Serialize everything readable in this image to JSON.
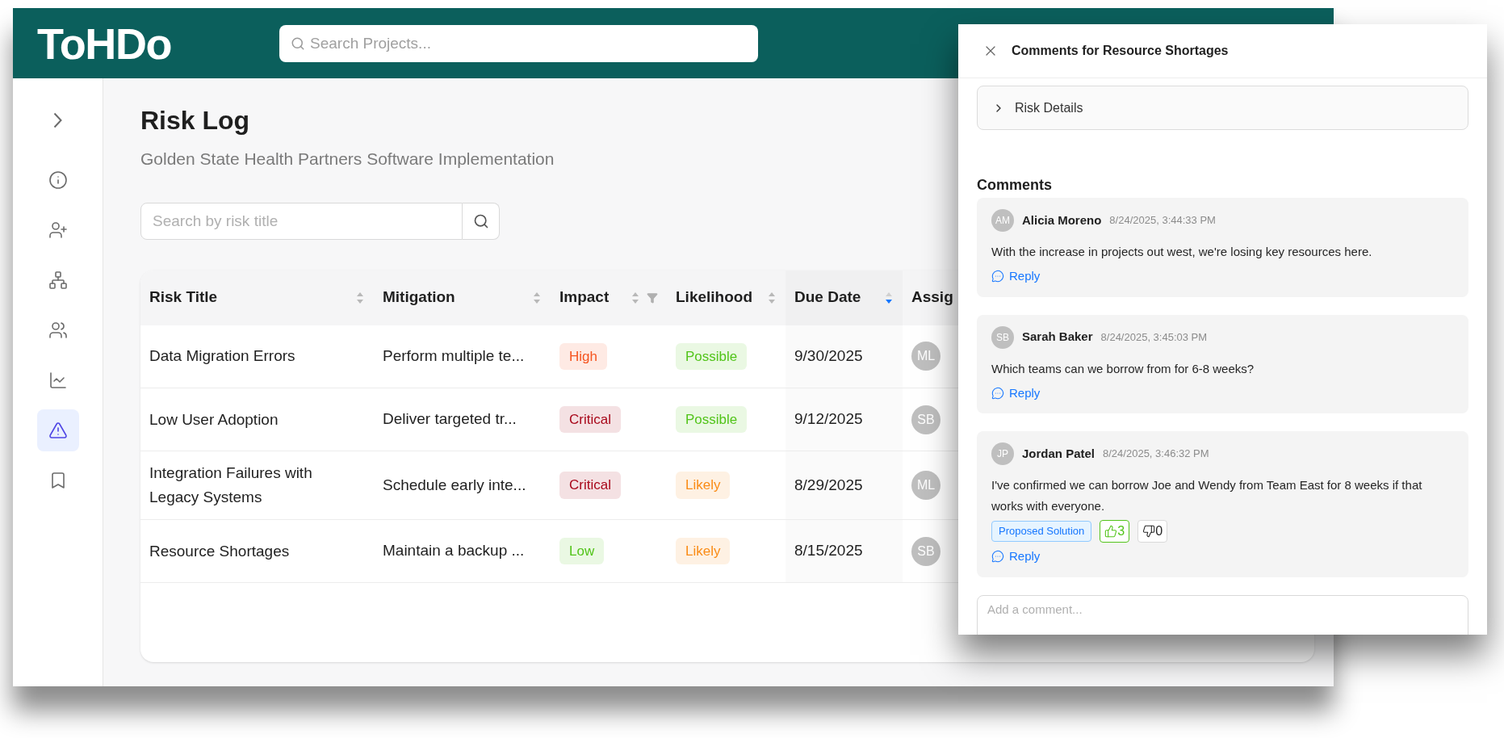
{
  "app": {
    "logo": "ToHDo",
    "search": {
      "placeholder": "Search Projects..."
    }
  },
  "sidebar": {
    "items": [
      {
        "kind": "expand",
        "selected": false
      },
      {
        "kind": "info",
        "selected": false
      },
      {
        "kind": "user-plus",
        "selected": false
      },
      {
        "kind": "network",
        "selected": false
      },
      {
        "kind": "users",
        "selected": false
      },
      {
        "kind": "chart",
        "selected": false
      },
      {
        "kind": "warning",
        "selected": true
      },
      {
        "kind": "book",
        "selected": false
      }
    ]
  },
  "page": {
    "title": "Risk Log",
    "subtitle": "Golden State Health Partners Software Implementation",
    "search": {
      "placeholder": "Search by risk title"
    }
  },
  "table": {
    "columns": [
      {
        "label": "Risk Title",
        "sorted": false,
        "filter": false
      },
      {
        "label": "Mitigation",
        "sorted": false,
        "filter": false
      },
      {
        "label": "Impact",
        "sorted": false,
        "filter": true
      },
      {
        "label": "Likelihood",
        "sorted": false,
        "filter": false
      },
      {
        "label": "Due Date",
        "sorted": true,
        "filter": false
      },
      {
        "label": "Assig"
      }
    ],
    "rows": [
      {
        "title": "Data Migration Errors",
        "mitigation": "Perform multiple te...",
        "impact": {
          "text": "High",
          "color": "#f5541f"
        },
        "likelihood": {
          "text": "Possible",
          "color": "#52c41a"
        },
        "due_date": "9/30/2025",
        "assignee": "ML"
      },
      {
        "title": "Low User Adoption",
        "mitigation": "Deliver targeted tr...",
        "impact": {
          "text": "Critical",
          "color": "#a8071a"
        },
        "likelihood": {
          "text": "Possible",
          "color": "#52c41a"
        },
        "due_date": "9/12/2025",
        "assignee": "SB"
      },
      {
        "title": "Integration Failures with Legacy Systems",
        "mitigation": "Schedule early inte...",
        "impact": {
          "text": "Critical",
          "color": "#a8071a"
        },
        "likelihood": {
          "text": "Likely",
          "color": "#fa8c16"
        },
        "due_date": "8/29/2025",
        "assignee": "ML"
      },
      {
        "title": "Resource Shortages",
        "mitigation": "Maintain a backup ...",
        "impact": {
          "text": "Low",
          "color": "#52c41a"
        },
        "likelihood": {
          "text": "Likely",
          "color": "#fa8c16"
        },
        "due_date": "8/15/2025",
        "assignee": "SB"
      }
    ]
  },
  "panel": {
    "title": "Comments for Resource Shortages",
    "details": {
      "label": "Risk Details",
      "expanded": false
    },
    "comments_heading": "Comments",
    "comments": [
      {
        "initials": "AM",
        "author": "Alicia Moreno",
        "time": "8/24/2025, 3:44:33 PM",
        "text": "With the increase in projects out west, we're losing key resources here.",
        "reply": "Reply"
      },
      {
        "initials": "SB",
        "author": "Sarah Baker",
        "time": "8/24/2025, 3:45:03 PM",
        "text": "Which teams can we borrow from for 6-8 weeks?",
        "reply": "Reply"
      },
      {
        "initials": "JP",
        "author": "Jordan Patel",
        "time": "8/24/2025, 3:46:32 PM",
        "text": "I've confirmed we can borrow Joe and Wendy from Team East for 8 weeks if that works with everyone.",
        "tags": [
          "Proposed Solution"
        ],
        "reactions": [
          {
            "kind": "up",
            "count": "3",
            "selected": true
          },
          {
            "kind": "down",
            "count": "0",
            "selected": false
          }
        ],
        "reply": "Reply"
      }
    ],
    "composer": {
      "placeholder": "Add a comment..."
    }
  }
}
